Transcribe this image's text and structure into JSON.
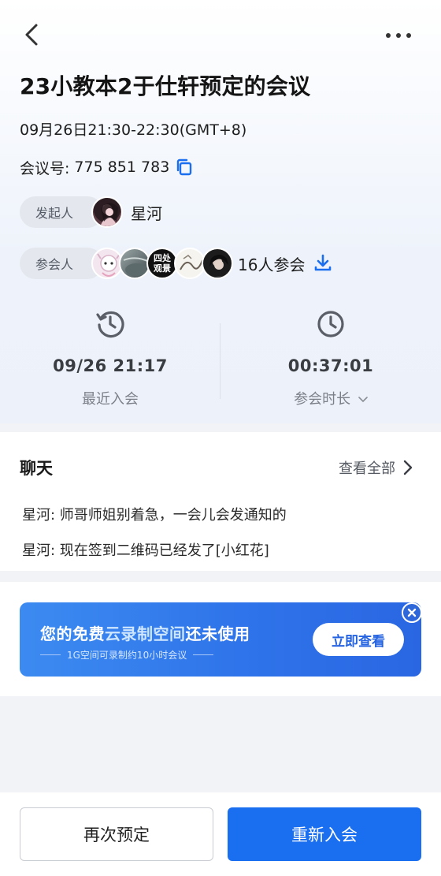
{
  "header": {
    "back_icon": "chevron-left-icon",
    "more_icon": "more-dots-icon"
  },
  "meeting": {
    "title": "23小教本2于仕轩预定的会议",
    "time_range": "09月26日21:30-22:30(GMT+8)",
    "id_label": "会议号:",
    "id_value": "775 851 783"
  },
  "host": {
    "label": "发起人",
    "name": "星河"
  },
  "attendees": {
    "label": "参会人",
    "count_text": "16人参会",
    "avatar_texts": [
      "四处",
      "观景"
    ]
  },
  "stats": {
    "last_join": {
      "value": "09/26 21:17",
      "label": "最近入会",
      "icon": "history-clock-icon"
    },
    "duration": {
      "value": "00:37:01",
      "label": "参会时长",
      "icon": "clock-icon"
    }
  },
  "chat": {
    "title": "聊天",
    "view_all": "查看全部",
    "messages": [
      "星河: 师哥师姐别着急，一会儿会发通知的",
      "星河: 现在签到二维码已经发了[小红花]"
    ]
  },
  "promo": {
    "title_pre": "您的免费",
    "title_highlight": "云录制空间",
    "title_post": "还未使用",
    "subtitle": "1G空间可录制约10小时会议",
    "cta": "立即查看"
  },
  "actions": {
    "rebook": "再次预定",
    "rejoin": "重新入会"
  },
  "colors": {
    "primary": "#1a6ef0",
    "banner": "#2f74ea",
    "background": "#f1f3f6"
  }
}
